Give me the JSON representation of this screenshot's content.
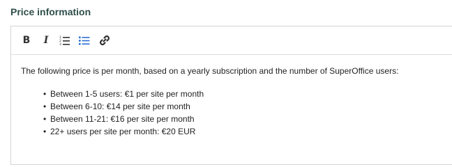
{
  "section": {
    "title": "Price information"
  },
  "toolbar": {
    "bold_label": "B",
    "italic_label": "I",
    "icons": [
      "ordered-list-icon",
      "unordered-list-icon",
      "link-icon"
    ],
    "active_color": "#2a6fd6"
  },
  "content": {
    "intro": "The following price is per month, based on a yearly subscription and the number of SuperOffice users:",
    "bullet_char": "•",
    "bullets": [
      "Between 1-5 users: €1 per site per month",
      "Between 6-10: €14 per site per month",
      "Between 11-21: €16 per site per month",
      "22+ users per site per month: €20 EUR"
    ]
  }
}
